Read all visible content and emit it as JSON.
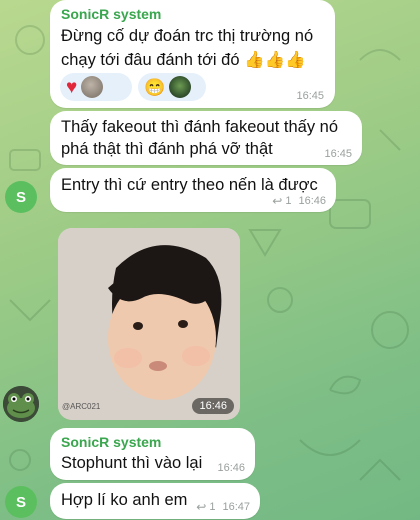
{
  "messages": [
    {
      "sender": "SonicR system",
      "lines": [
        "Đừng cố dự đoán trc thị trường nó",
        "chạy tới đâu đánh tới đó 👍👍👍"
      ],
      "reactions": [
        "red-heart",
        "user-avatar",
        "grinning-face",
        "frog-avatar"
      ],
      "time": "16:45"
    },
    {
      "lines": [
        "Thấy fakeout thì đánh fakeout thấy nó",
        "phá thật thì đánh phá vỡ thật"
      ],
      "time": "16:45"
    },
    {
      "avatar_letter": "S",
      "lines": [
        "Entry thì cứ entry theo nến là được"
      ],
      "reply_count": "1",
      "time": "16:46"
    },
    {
      "watermark": "@ARC021",
      "time": "16:46"
    },
    {
      "sender": "SonicR system",
      "lines": [
        "Stophunt thì vào lại"
      ],
      "time": "16:46"
    },
    {
      "avatar_letter": "S",
      "lines": [
        "Hợp lí ko anh em"
      ],
      "reply_count": "1",
      "time": "16:47"
    }
  ],
  "colors": {
    "sender": "#3aa64e",
    "avatar": "#5cbf5f",
    "bubble": "#ffffff"
  },
  "icons": [
    "reply-arrow-icon",
    "frog-avatar",
    "user-avatar",
    "grinning-face",
    "red-heart"
  ]
}
